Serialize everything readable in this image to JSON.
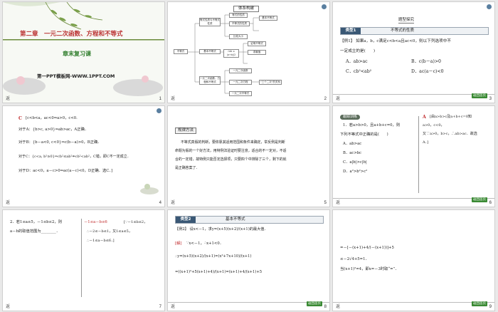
{
  "slides": {
    "s1": {
      "chapter": "第二章　一元二次函数、方程和不等式",
      "subtitle": "章末复习课",
      "footer_link": "第一PPT模板网-WWW.1PPT.COM",
      "num": "1"
    },
    "s2": {
      "heading": "体系构建",
      "center": "不等式",
      "nodes": [
        "等式性质与不等式性质",
        "基本不等式",
        "一元二次函数、方程和不等式"
      ],
      "leaves": [
        "等式的性质",
        "不等式的性质",
        "比较大小",
        "基本不等式",
        "证明不等式",
        "求最值",
        "一元二次函数",
        "一元二次方程",
        "一元二次不等式",
        "“三个二次”的关系"
      ],
      "formula": "√ab ≤ (a+b)/2",
      "num": "2"
    },
    "s3": {
      "heading": "题型探究",
      "cat_tag": "类型1",
      "cat_title": "不等式的性质",
      "example": "【例1】 如果a，b，c满足c<b<a且ac<0，则以下列选项中不",
      "example2": "一定成立的是(　　)",
      "optA": "A．ab>ac",
      "optB": "B．c(b－a)>0",
      "optC": "C．cb²<ab²",
      "optD": "D．ac(a－c)<0",
      "num": "3"
    },
    "s4": {
      "answer": "C",
      "l1": "[c<b<a，ac<0⇒a>0，c<0.",
      "l2": "对于A：{b>c, a>0}⇒ab>ac，A正确．",
      "l3": "对于B：{b－a<0, c<0}⇒c(b－a)>0，B正确．",
      "l4": "对于C：{c<a, b²≥0}⇒cb²≤ab²⇏cb²<ab²，C错，即C不一定成立．",
      "l5": "对于D：ac<0，a－c>0⇒ac(a－c)<0，D正确．选C．]",
      "num": "4"
    },
    "s5": {
      "tag": "规律方法",
      "text": [
        "不等式真假的判断，要依靠其适用范围和条件来确定，举反例是判断",
        "命题为假的一个好方法，用特例法验证时要注意，适合的不一定对，不适",
        "合的一定错，故特例只能否定选择项，只要四个中排除了三个，剩下的就",
        "是正确答案了．"
      ],
      "num": "5"
    },
    "s6": {
      "tag": "跟踪训练",
      "q": "1．若a>b>0，且a+b+c=0，则",
      "q2": "下列不等式中正确的是(　　)",
      "optA": "A．ab>ac",
      "optB": "B．ac>bc",
      "optC": "C．a|b|>c|b|",
      "optD": "D．a²>b²>c²",
      "ans": "A",
      "sol1": "[由a>b>c及a+b+c=0知",
      "sol2": "a>0，c<0，",
      "sol3": "又∵a>0，b>c，∴ab>ac．故选",
      "sol4": "A．]",
      "num": "6"
    },
    "s7": {
      "q1": "2．若1≤a≤5，－1≤b≤2，则",
      "q2": "a－b的取值范围为________．",
      "ans": "－1≤a－b≤6",
      "sol1": "[∵－1≤b≤2，",
      "sol2": "∴－2≤－b≤1，又1≤a≤5，",
      "sol3": "∴－1≤a－b≤6．]",
      "num": "7"
    },
    "s8": {
      "cat_tag": "类型2",
      "cat_title": "基本不等式",
      "example": "【例2】 设x<－1，求y=(x+5)(x+2)/(x+1)的最大值．",
      "sol_tag": "[解]",
      "l1": "∵x<－1，∴x+1<0．",
      "l2": "∴y=(x+5)(x+2)/(x+1)=(x²+7x+10)/(x+1)",
      "l3": "=((x+1)²+5(x+1)+4)/(x+1)=(x+1)+4/(x+1)+5",
      "num": "8"
    },
    "s9": {
      "l1": "=－[－(x+1)+4/(－(x+1))]+5",
      "l2": "≤－2√4+5=1．",
      "l3": "当(x+1)²=4，即x=－3时取“=”．",
      "num": "9"
    },
    "footer_mark": "返",
    "back_label": "返回首页"
  },
  "colors": {
    "accent_green": "#2f7d2b",
    "answer_red": "#c0292b",
    "tag_blue": "#3a5875"
  }
}
